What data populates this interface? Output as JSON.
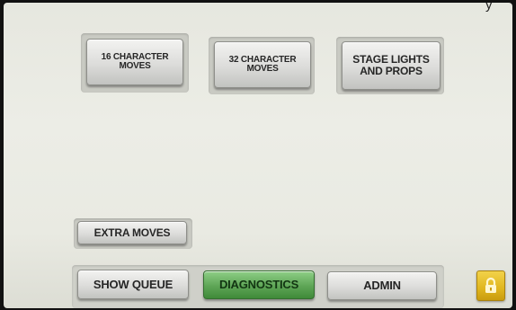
{
  "top_buttons": [
    {
      "label": "16 CHARACTER\nMOVES"
    },
    {
      "label": "32 CHARACTER\nMOVES"
    },
    {
      "label": "STAGE LIGHTS\nAND PROPS"
    }
  ],
  "extra_moves_label": "EXTRA MOVES",
  "bottom_nav": {
    "show_queue_label": "SHOW QUEUE",
    "diagnostics_label": "DIAGNOSTICS",
    "admin_label": "ADMIN",
    "active_tab": "DIAGNOSTICS"
  },
  "lock": {
    "icon": "lock-icon",
    "color": "#e0b61e"
  },
  "colors": {
    "background": "#e9eae2",
    "button": "#dcdcda",
    "active": "#5ea556"
  }
}
